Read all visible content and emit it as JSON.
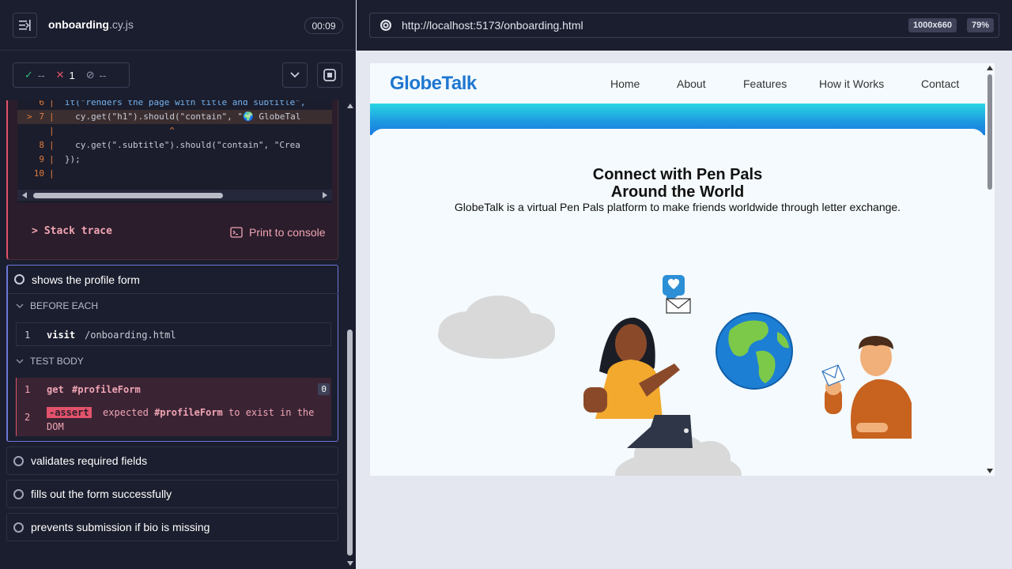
{
  "header": {
    "spec_name": "onboarding",
    "spec_ext": ".cy.js",
    "timer": "00:09"
  },
  "stats": {
    "passed": "--",
    "failed": "1",
    "pending": "--"
  },
  "code_frame": {
    "lines": [
      {
        "num": "6",
        "code": "  it(\"renders the page with title and subtitle\","
      },
      {
        "num": "7",
        "code": "    cy.get(\"h1\").should(\"contain\", \"🌍 GlobeTal"
      },
      {
        "num": "",
        "code": "                      ^"
      },
      {
        "num": "8",
        "code": "    cy.get(\".subtitle\").should(\"contain\", \"Crea"
      },
      {
        "num": "9",
        "code": "  });"
      },
      {
        "num": "10",
        "code": ""
      }
    ]
  },
  "error_actions": {
    "stack_trace": "Stack trace",
    "print_console": "Print to console"
  },
  "current_test": {
    "title": "shows the profile form",
    "before_each_label": "BEFORE EACH",
    "test_body_label": "TEST BODY",
    "before_cmd": {
      "num": "1",
      "name": "visit",
      "msg": "/onboarding.html"
    },
    "body_cmd1": {
      "num": "1",
      "name": "get",
      "msg": "#profileForm",
      "badge": "0"
    },
    "body_cmd2": {
      "num": "2",
      "name": "-assert",
      "msg1": "expected",
      "msg2": "#profileForm",
      "msg3": "to exist in the",
      "msg4": "DOM"
    }
  },
  "tests": [
    "validates required fields",
    "fills out the form successfully",
    "prevents submission if bio is missing"
  ],
  "browser": {
    "url": "http://localhost:5173/onboarding.html",
    "viewport": "1000x660",
    "zoom": "79%"
  },
  "site": {
    "logo": "GlobeTalk",
    "nav": [
      "Home",
      "About",
      "Features",
      "How it Works",
      "Contact"
    ],
    "hero_title_line1": "Connect with Pen Pals",
    "hero_title_line2": "Around the World",
    "hero_subtitle": "GlobeTalk is a virtual Pen Pals platform to make friends worldwide through letter exchange."
  },
  "colors": {
    "accent": "#6b78d8",
    "fail": "#e2526b",
    "brand": "#1f77d0"
  }
}
